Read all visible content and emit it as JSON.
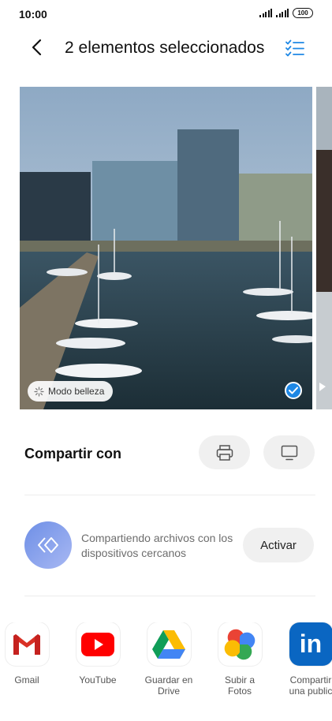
{
  "status_bar": {
    "time": "10:00",
    "battery": "100"
  },
  "header": {
    "title": "2 elementos seleccionados",
    "back_icon": "back-arrow-icon",
    "select_icon": "select-all-list-icon",
    "accent_color": "#1e88e5"
  },
  "photo": {
    "beauty_mode_label": "Modo belleza",
    "selected": true
  },
  "share": {
    "label": "Compartir con",
    "print_icon": "printer-icon",
    "cast_icon": "monitor-icon"
  },
  "nearby": {
    "description": "Compartiendo archivos con los dispositivos cercanos",
    "activate_label": "Activar"
  },
  "apps": [
    {
      "name": "Gmail",
      "icon": "gmail-icon"
    },
    {
      "name": "YouTube",
      "icon": "youtube-icon"
    },
    {
      "name": "Guardar en\nDrive",
      "icon": "google-drive-icon"
    },
    {
      "name": "Subir a\nFotos",
      "icon": "google-photos-icon"
    },
    {
      "name": "Compartir\nuna public",
      "icon": "linkedin-icon"
    }
  ]
}
